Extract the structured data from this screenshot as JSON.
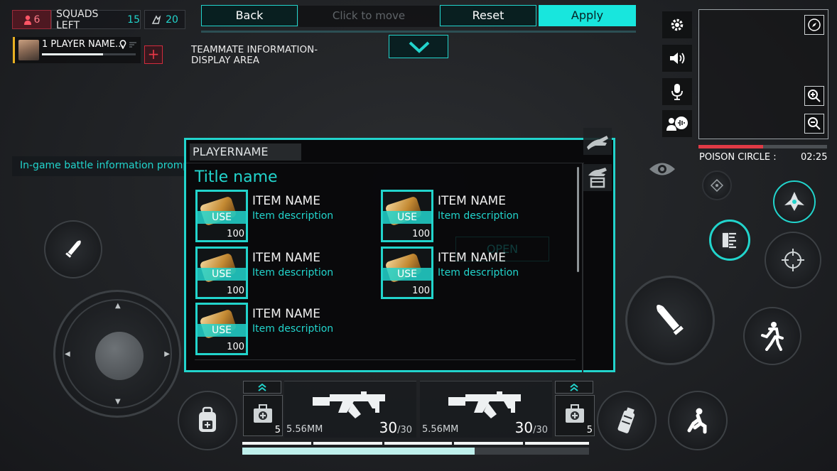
{
  "hud": {
    "players_count": "6",
    "squads_label": "SQUADS LEFT",
    "squads_count": "15",
    "kills_count": "20",
    "player_name": "1 PLAYER NAME...",
    "player_health_pct": 65,
    "teammate_area_line1": "TEAMMATE INFORMATION-",
    "teammate_area_line2": "DISPLAY AREA",
    "battle_info": "In-game battle information prompt"
  },
  "edit_bar": {
    "back_label": "Back",
    "click_to_move": "Click to move",
    "reset_label": "Reset",
    "apply_label": "Apply"
  },
  "minimap": {
    "poison_label": "POISON CIRCLE :",
    "poison_time": "02:25",
    "poison_progress_pct": 50
  },
  "backpack": {
    "player_name": "PLAYERNAME",
    "title": "Title name",
    "use_label": "USE",
    "items": [
      {
        "name": "ITEM NAME",
        "description": "Item description",
        "quantity": "100"
      },
      {
        "name": "ITEM NAME",
        "description": "Item description",
        "quantity": "100"
      },
      {
        "name": "ITEM NAME",
        "description": "Item description",
        "quantity": "100"
      },
      {
        "name": "ITEM NAME",
        "description": "Item description",
        "quantity": "100"
      },
      {
        "name": "ITEM NAME",
        "description": "Item description",
        "quantity": "100"
      }
    ],
    "ghost_open_label": "OPEN"
  },
  "weapons": {
    "left_heal_count": "5",
    "right_heal_count": "5",
    "primary": {
      "caliber": "5.56MM",
      "ammo": "30",
      "max": "/30"
    },
    "secondary": {
      "caliber": "5.56MM",
      "ammo": "30",
      "max": "/30"
    },
    "health_pct": 67
  },
  "colors": {
    "accent": "#22d4cc",
    "danger": "#e03a45",
    "apply_bg": "#18e6dd"
  }
}
